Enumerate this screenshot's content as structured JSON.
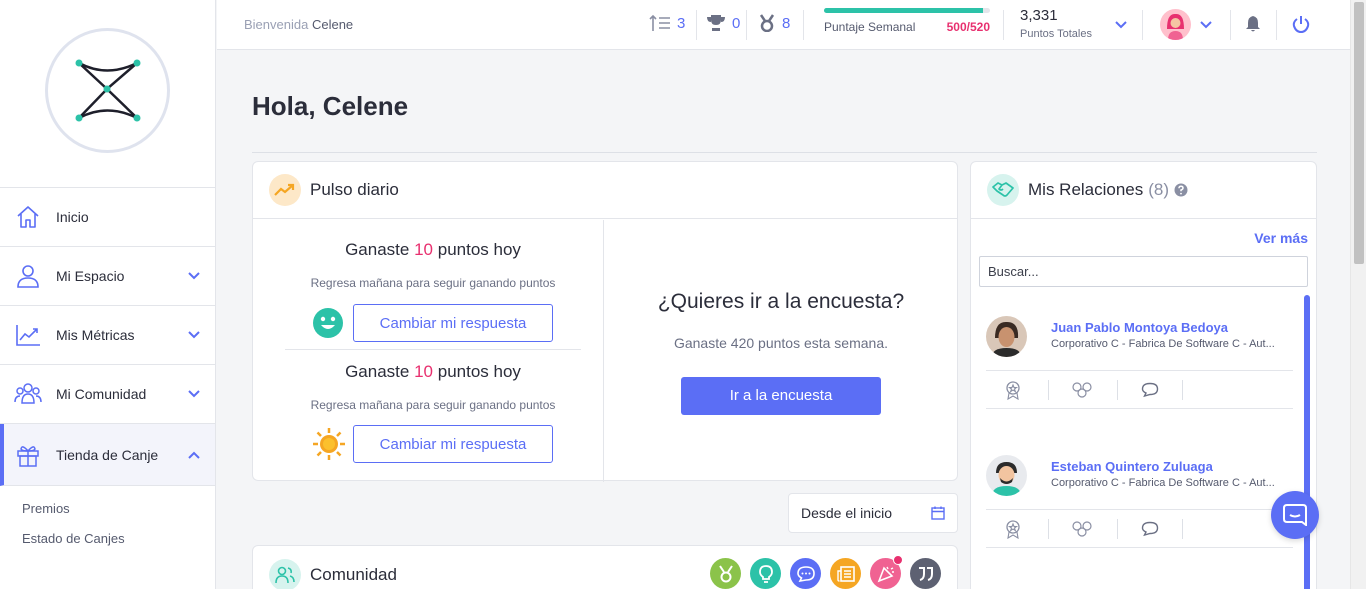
{
  "colors": {
    "accent": "#5b6ef5",
    "highlight": "#e8306f",
    "teal": "#2cc2a8"
  },
  "sidebar": {
    "items": [
      {
        "label": "Inicio",
        "icon": "home-icon"
      },
      {
        "label": "Mi Espacio",
        "icon": "user-icon"
      },
      {
        "label": "Mis Métricas",
        "icon": "chart-icon"
      },
      {
        "label": "Mi Comunidad",
        "icon": "group-icon"
      },
      {
        "label": "Tienda de Canje",
        "icon": "gift-icon"
      }
    ],
    "subitems": [
      "Premios",
      "Estado de Canjes"
    ]
  },
  "header": {
    "welcome_prefix": "Bienvenida",
    "user_name": "Celene",
    "stats": {
      "ranking": "3",
      "trophies": "0",
      "medals": "8"
    },
    "weekly_label": "Puntaje Semanal",
    "weekly_points": "500",
    "weekly_target": "/520",
    "weekly_progress": 0.96,
    "total_points": "3,331",
    "total_label": "Puntos Totales"
  },
  "main": {
    "greeting": "Hola, Celene"
  },
  "pulse": {
    "title": "Pulso diario",
    "entries": [
      {
        "prefix": "Ganaste",
        "points": "10",
        "suffix": "puntos hoy",
        "note": "Regresa mañana para seguir ganando puntos",
        "button": "Cambiar mi respuesta",
        "icon": "smiley-icon"
      },
      {
        "prefix": "Ganaste",
        "points": "10",
        "suffix": "puntos hoy",
        "note": "Regresa mañana para seguir ganando puntos",
        "button": "Cambiar mi respuesta",
        "icon": "sun-icon"
      }
    ],
    "survey_question": "¿Quieres ir a la encuesta?",
    "survey_sub": "Ganaste 420 puntos esta semana.",
    "survey_button": "Ir a la encuesta"
  },
  "date_filter": {
    "label": "Desde el inicio"
  },
  "community": {
    "title": "Comunidad",
    "icons": [
      "badge-icon",
      "lightbulb-icon",
      "chat-icon",
      "newspaper-icon",
      "party-icon",
      "quote-icon"
    ]
  },
  "relations": {
    "title": "Mis Relaciones",
    "count": "(8)",
    "see_more": "Ver más",
    "search_placeholder": "Buscar...",
    "people": [
      {
        "name": "Juan Pablo Montoya Bedoya",
        "org": "Corporativo C - Fabrica De Software C - Aut..."
      },
      {
        "name": "Esteban Quintero Zuluaga",
        "org": "Corporativo C - Fabrica De Software C - Aut..."
      }
    ]
  }
}
